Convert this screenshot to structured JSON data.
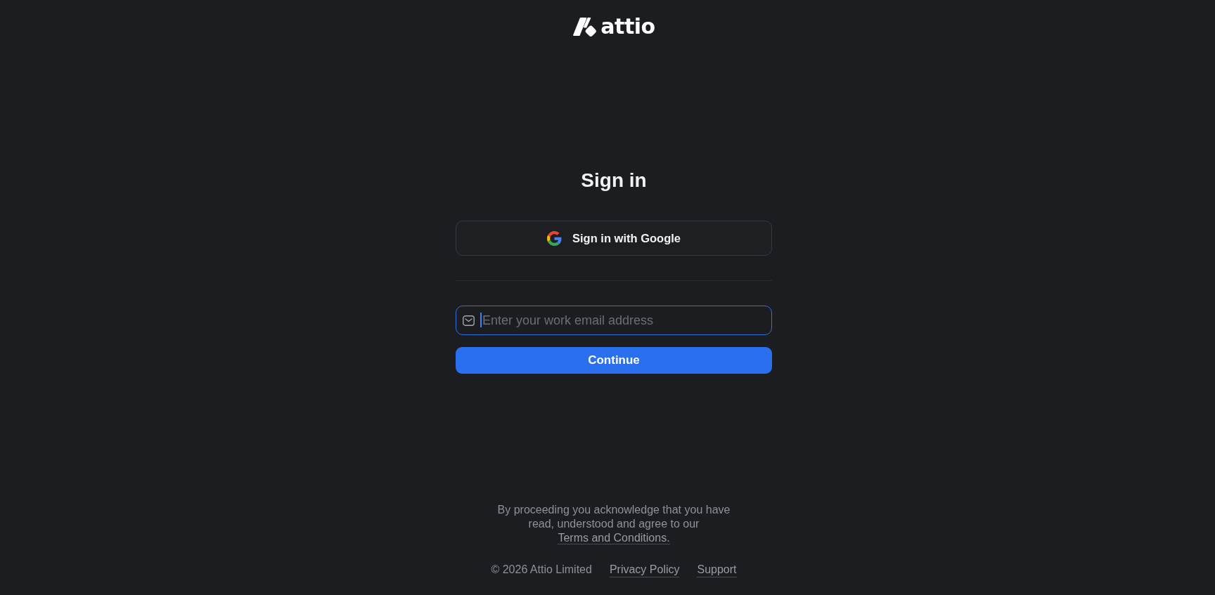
{
  "logo": {
    "wordmark": "attio"
  },
  "heading": "Sign in",
  "google_button": {
    "label": "Sign in with Google"
  },
  "email_field": {
    "placeholder": "Enter your work email address",
    "focused": true
  },
  "continue_button": {
    "label": "Continue"
  },
  "consent": {
    "text": "By proceeding you acknowledge that you have read, understood and agree to our",
    "link": "Terms and Conditions."
  },
  "footer": {
    "copyright": "© 2026 Attio Limited",
    "links": [
      "Privacy Policy",
      "Support"
    ]
  }
}
